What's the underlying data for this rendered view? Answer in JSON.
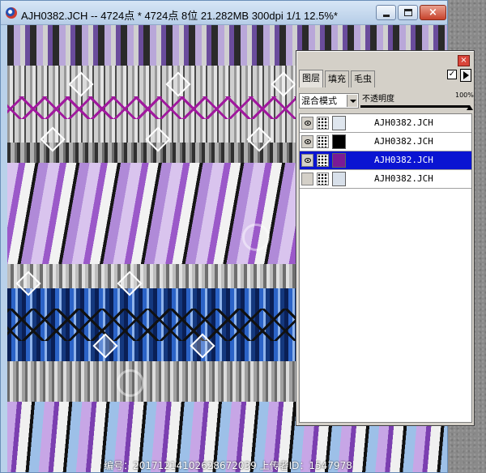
{
  "window": {
    "title": "AJH0382.JCH -- 4724点 * 4724点 8位  21.282MB 300dpi 1/1  12.5%*",
    "buttons": {
      "minimize": "minimize",
      "maximize": "maximize",
      "close": "×"
    }
  },
  "layers_palette": {
    "close_label": "×",
    "tabs": [
      {
        "label": "图层",
        "active": true
      },
      {
        "label": "填充",
        "active": false
      },
      {
        "label": "毛虫",
        "active": false
      }
    ],
    "checkbox_mark": "✓",
    "blend_mode": "混合模式",
    "opacity_label": "不透明度",
    "opacity_value": "100%",
    "opacity_level": 1.0,
    "layers": [
      {
        "name": "AJH0382.JCH",
        "color": "#dfe6ee",
        "selected": false,
        "visible": true
      },
      {
        "name": "AJH0382.JCH",
        "color": "#000000",
        "selected": false,
        "visible": true
      },
      {
        "name": "AJH0382.JCH",
        "color": "#7a1a96",
        "selected": true,
        "visible": true
      },
      {
        "name": "AJH0382.JCH",
        "color": "#d8e0ea",
        "selected": false,
        "visible": false
      }
    ]
  },
  "watermark": {
    "caption": "编号：20171214102628672039 上传者ID：1547978"
  },
  "colors": {
    "selection": "#0a14d2",
    "palette_bg": "#d4d0c8",
    "titlebar": "#c8daf0"
  }
}
